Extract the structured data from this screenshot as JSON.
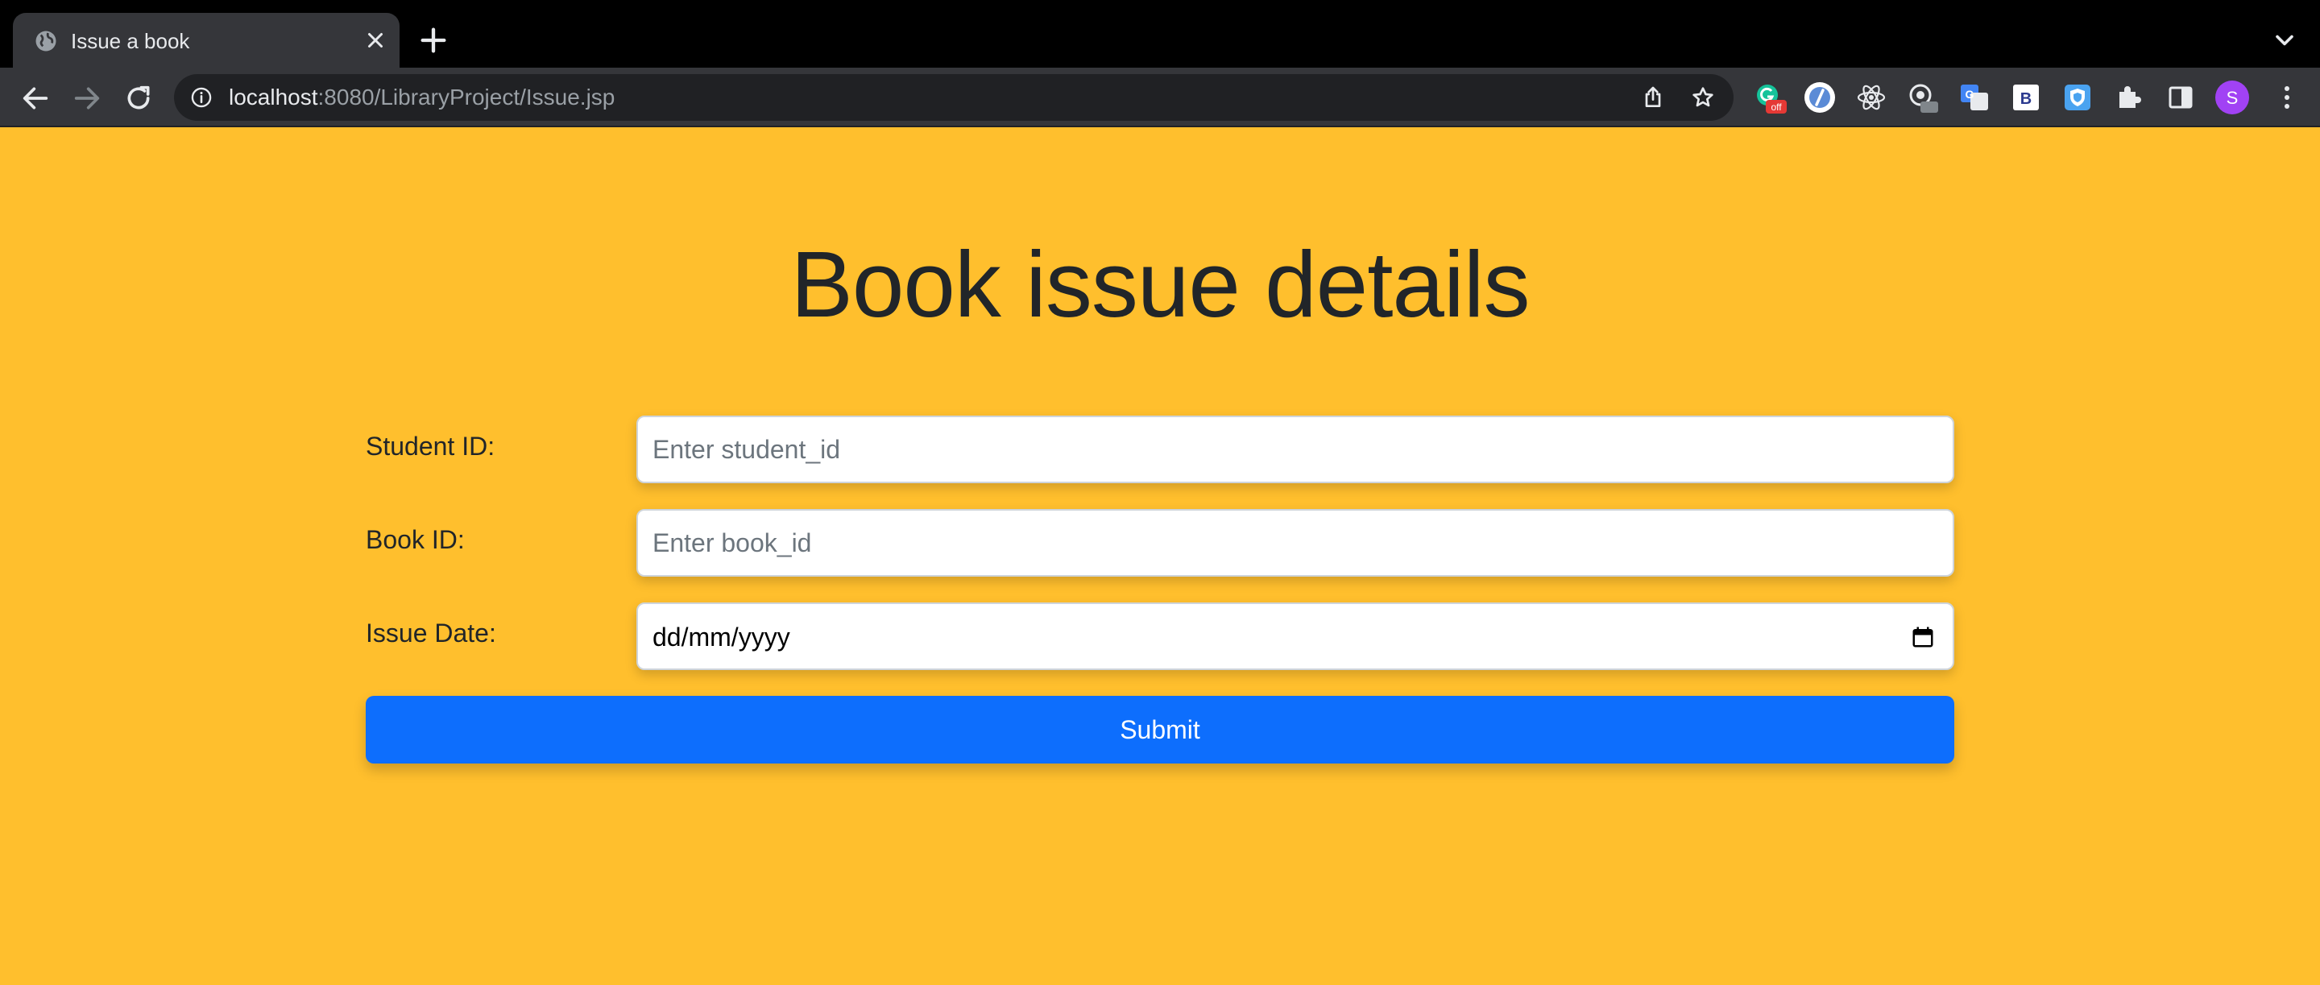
{
  "browser": {
    "tab_title": "Issue a book",
    "url_host": "localhost",
    "url_path": ":8080/LibraryProject/Issue.jsp",
    "extensions": [
      "grammarly-icon",
      "ext-circle-icon",
      "react-devtools-icon",
      "ext-badge-icon",
      "google-translate-icon",
      "bootstrap-icon",
      "shield-ext-icon",
      "puzzle-icon"
    ],
    "grammarly_badge": "off",
    "profile_initial": "S",
    "colors": {
      "tabstrip": "#000000",
      "toolbar": "#35363a",
      "omnibox": "#202124",
      "profile": "#a142f4"
    }
  },
  "page": {
    "title": "Book issue details",
    "background": "#ffbf2d",
    "fields": [
      {
        "label": "Student ID:",
        "placeholder": "Enter student_id"
      },
      {
        "label": "Book ID:",
        "placeholder": "Enter book_id"
      },
      {
        "label": "Issue Date:",
        "value": "dd/mm/yyyy"
      }
    ],
    "submit_label": "Submit",
    "submit_color": "#0d6efd"
  }
}
